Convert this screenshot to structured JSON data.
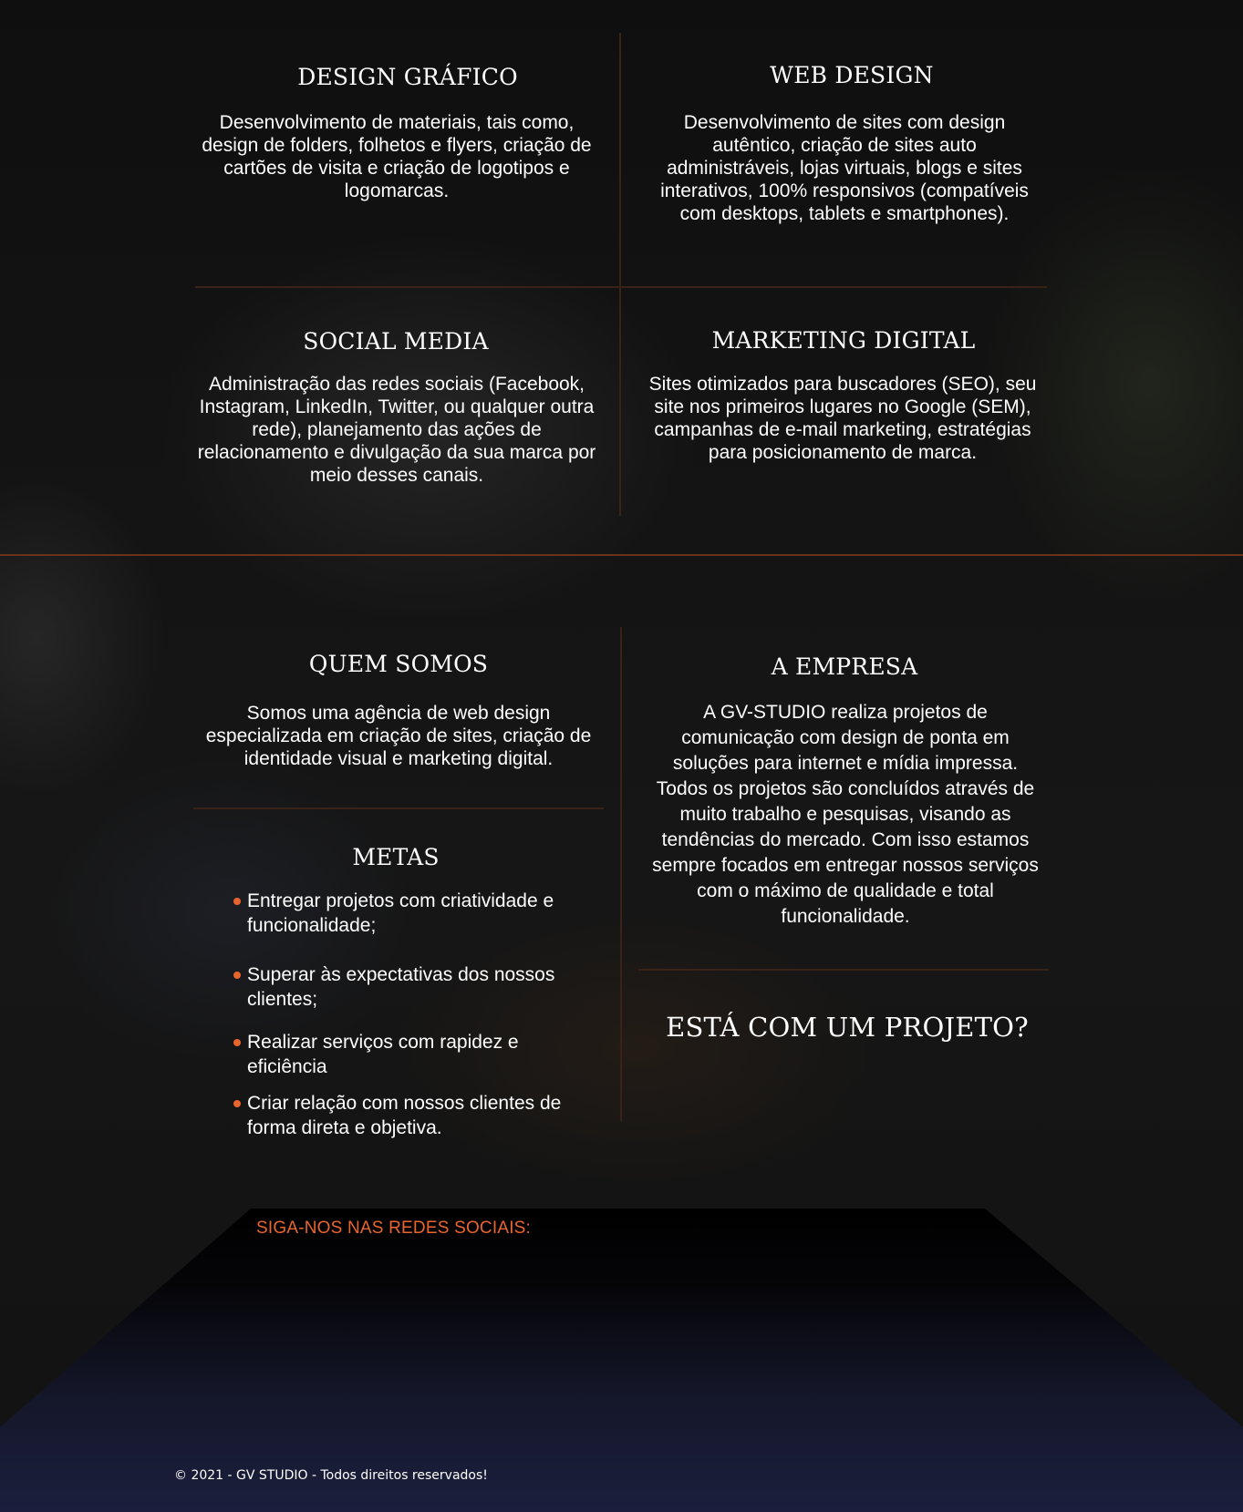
{
  "services": {
    "design_grafico": {
      "title": "DESIGN GRÁFICO",
      "text": "Desenvolvimento de materiais, tais como, design de folders, folhetos e flyers, criação de cartões de visita e criação de logotipos e logomarcas."
    },
    "web_design": {
      "title": "WEB DESIGN",
      "text": "Desenvolvimento de sites com design autêntico, criação de sites auto administráveis, lojas virtuais, blogs e sites interativos, 100% responsivos (compatíveis com desktops, tablets e smartphones)."
    },
    "social_media": {
      "title": "SOCIAL MEDIA",
      "text": "Administração das redes sociais (Facebook, Instagram, LinkedIn, Twitter, ou qualquer outra rede), planejamento das ações de relacionamento e divulgação da sua marca por meio desses canais."
    },
    "marketing_digital": {
      "title": "MARKETING DIGITAL",
      "text": "Sites otimizados para buscadores (SEO), seu site nos primeiros lugares no Google (SEM), campanhas de e-mail marketing, estratégias para posicionamento de marca."
    }
  },
  "about": {
    "quem_somos": {
      "title": "QUEM SOMOS",
      "text": "Somos uma agência de web design especializada em criação de sites, criação de identidade visual e marketing digital."
    },
    "metas": {
      "title": "METAS",
      "items": [
        "Entregar projetos com criatividade e funcionalidade;",
        "Superar às expectativas dos nossos clientes;",
        "Realizar serviços com rapidez e eficiência",
        "Criar relação com nossos clientes de forma direta e objetiva."
      ]
    },
    "empresa": {
      "title": "A EMPRESA",
      "text": "A GV-STUDIO realiza projetos de comunicação com design de ponta em soluções para internet e mídia impressa. Todos os projetos são concluídos através de muito trabalho e pesquisas, visando as tendências do mercado. Com isso estamos sempre focados em entregar nossos serviços com o máximo de qualidade e total funcionalidade."
    },
    "projeto": {
      "title": "ESTÁ COM UM PROJETO?"
    }
  },
  "footer": {
    "social_label": "SIGA-NOS NAS REDES SOCIAIS:",
    "copyright": "© 2021 - GV STUDIO - Todos direitos reservados!"
  },
  "colors": {
    "accent": "#e8662e",
    "divider": "#3a2218",
    "footer_bg": "#1b1f3d"
  }
}
